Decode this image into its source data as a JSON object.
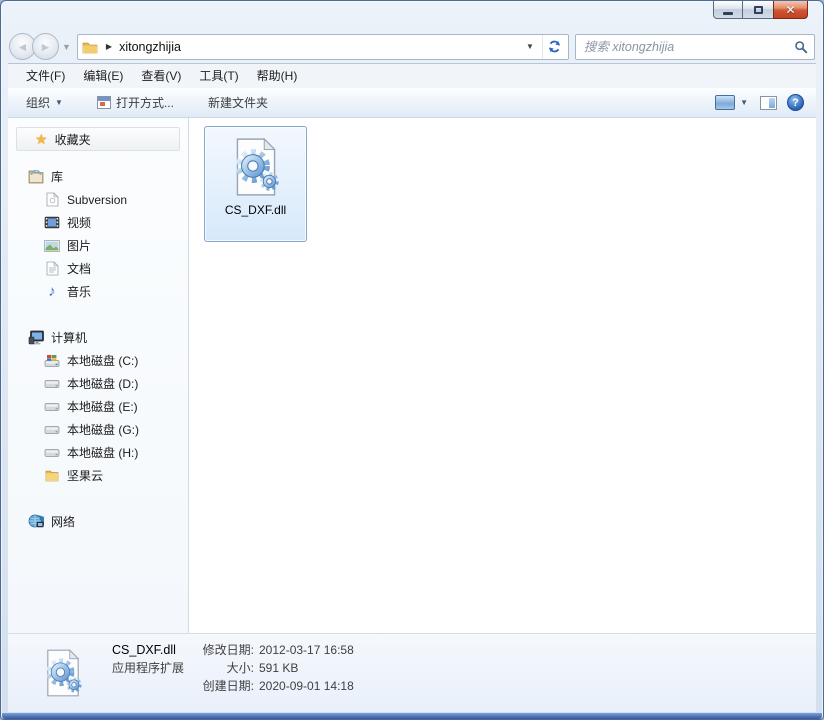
{
  "address": {
    "crumb": "xitongzhijia",
    "breadcrumb_arrow": "▶",
    "dropdown_glyph": "▼"
  },
  "nav": {
    "back_glyph": "◄",
    "forward_glyph": "►",
    "history_chevron": "▼"
  },
  "search": {
    "placeholder": "搜索 xitongzhijia"
  },
  "titlebar": {
    "close_glyph": "✕"
  },
  "menu": {
    "items": [
      "文件(F)",
      "编辑(E)",
      "查看(V)",
      "工具(T)",
      "帮助(H)"
    ]
  },
  "toolbar": {
    "organize_label": "组织",
    "organize_caret": "▼",
    "open_with_label": "打开方式...",
    "new_folder_label": "新建文件夹",
    "views_caret": "▼",
    "help_glyph": "?"
  },
  "sidebar": {
    "favorites_label": "收藏夹",
    "favorites_star": "★",
    "items": [
      {
        "label": "库"
      },
      {
        "label": "Subversion"
      },
      {
        "label": "视频"
      },
      {
        "label": "图片"
      },
      {
        "label": "文档"
      },
      {
        "label": "音乐"
      },
      {
        "label": "计算机"
      },
      {
        "label": "本地磁盘 (C:)"
      },
      {
        "label": "本地磁盘 (D:)"
      },
      {
        "label": "本地磁盘 (E:)"
      },
      {
        "label": "本地磁盘 (G:)"
      },
      {
        "label": "本地磁盘 (H:)"
      },
      {
        "label": "坚果云"
      },
      {
        "label": "网络"
      }
    ],
    "music_note": "♪"
  },
  "main": {
    "file_label": "CS_DXF.dll"
  },
  "details": {
    "file_name": "CS_DXF.dll",
    "file_type": "应用程序扩展",
    "modified_label": "修改日期:",
    "modified_value": "2012-03-17 16:58",
    "size_label": "大小:",
    "size_value": "591 KB",
    "created_label": "创建日期:",
    "created_value": "2020-09-01 14:18"
  },
  "colors": {
    "selection_border": "#84a7d3",
    "selection_fill": "#d6e9fb",
    "chrome": "#dfe8f3",
    "frame_bottom_blue": "#34549c",
    "close_button_red": "#cf5432"
  }
}
